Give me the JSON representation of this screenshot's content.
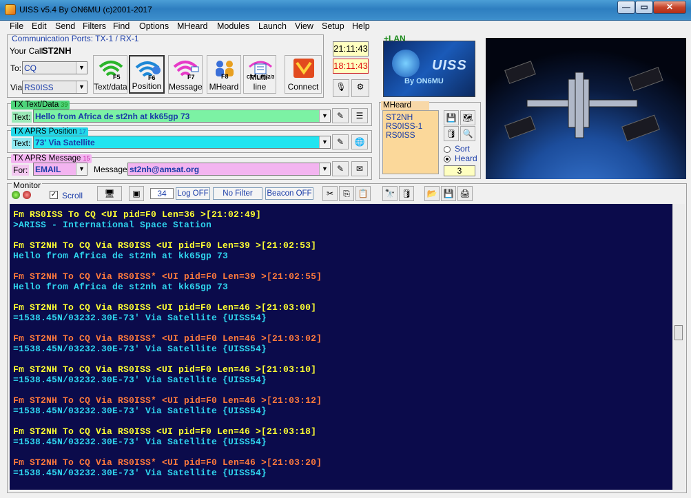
{
  "window": {
    "title": "UISS v5.4 By ON6MU (c)2001-2017",
    "controls": [
      "—",
      "▭",
      "✕"
    ]
  },
  "menu": [
    "File",
    "Edit",
    "Send",
    "Filters",
    "Find",
    "Options",
    "MHeard",
    "Modules",
    "Launch",
    "View",
    "Setup",
    "Help"
  ],
  "ports": {
    "title": "Communication Ports: TX-1 / RX-1",
    "your_call_label": "Your Call:",
    "your_call": "ST2NH",
    "to_label": "To:",
    "to_value": "CQ",
    "via_label": "Via:",
    "via_value": "RS0ISS"
  },
  "buttons": [
    {
      "label": "Text/data",
      "key": "F5"
    },
    {
      "label": "Position",
      "key": "F6"
    },
    {
      "label": "Message",
      "key": "F7"
    },
    {
      "label": "MHeard",
      "key": "F8"
    },
    {
      "label": "Multi-line",
      "key": "CTRL F1/2/3"
    },
    {
      "label": "Connect",
      "key": ""
    }
  ],
  "clocks": {
    "local": "21:11:43",
    "utc": "18:11:43"
  },
  "lan_label": "+LAN",
  "logo": {
    "text": "UISS",
    "byline": "By ON6MU"
  },
  "tx_text": {
    "title": "TX Text/Data",
    "count": "39",
    "label": "Text:",
    "value": "Hello from Africa de st2nh at kk65gp 73"
  },
  "tx_aprs_pos": {
    "title": "TX APRS Position",
    "count": "17",
    "label": "Text:",
    "value": "73' Via Satellite"
  },
  "tx_aprs_msg": {
    "title": "TX APRS Message",
    "count": "15",
    "for_label": "For:",
    "for_value": "EMAIL",
    "msg_label": "Message:",
    "msg_value": "st2nh@amsat.org"
  },
  "mheard": {
    "title": "MHeard",
    "items": [
      "ST2NH",
      "RS0ISS-1",
      "RS0ISS"
    ],
    "sort_label": "Sort",
    "heard_label": "Heard",
    "count": "3"
  },
  "monitor": {
    "title": "Monitor",
    "scroll_label": "Scroll",
    "count": "34",
    "log_btn": "Log OFF",
    "filter_btn": "No Filter",
    "beacon_btn": "Beacon OFF"
  },
  "console": [
    {
      "type": "hdr-y",
      "text": "Fm RS0ISS To CQ <UI pid=F0 Len=36 >[21:02:49]"
    },
    {
      "type": "body-c",
      "text": ">ARISS - International Space Station"
    },
    {
      "type": "hdr-y",
      "text": "Fm ST2NH To CQ Via RS0ISS <UI pid=F0 Len=39 >[21:02:53]"
    },
    {
      "type": "body-c",
      "text": "Hello from Africa de st2nh at kk65gp 73"
    },
    {
      "type": "hdr-o",
      "text": "Fm ST2NH To CQ Via RS0ISS* <UI pid=F0 Len=39 >[21:02:55]"
    },
    {
      "type": "body-c",
      "text": "Hello from Africa de st2nh at kk65gp 73"
    },
    {
      "type": "hdr-y",
      "text": "Fm ST2NH To CQ Via RS0ISS <UI pid=F0 Len=46 >[21:03:00]"
    },
    {
      "type": "body-c",
      "text": "=1538.45N/03232.30E-73' Via Satellite {UISS54}"
    },
    {
      "type": "hdr-o",
      "text": "Fm ST2NH To CQ Via RS0ISS* <UI pid=F0 Len=46 >[21:03:02]"
    },
    {
      "type": "body-c",
      "text": "=1538.45N/03232.30E-73' Via Satellite {UISS54}"
    },
    {
      "type": "hdr-y",
      "text": "Fm ST2NH To CQ Via RS0ISS <UI pid=F0 Len=46 >[21:03:10]"
    },
    {
      "type": "body-c",
      "text": "=1538.45N/03232.30E-73' Via Satellite {UISS54}"
    },
    {
      "type": "hdr-o",
      "text": "Fm ST2NH To CQ Via RS0ISS* <UI pid=F0 Len=46 >[21:03:12]"
    },
    {
      "type": "body-c",
      "text": "=1538.45N/03232.30E-73' Via Satellite {UISS54}"
    },
    {
      "type": "hdr-y",
      "text": "Fm ST2NH To CQ Via RS0ISS <UI pid=F0 Len=46 >[21:03:18]"
    },
    {
      "type": "body-c",
      "text": "=1538.45N/03232.30E-73' Via Satellite {UISS54}"
    },
    {
      "type": "hdr-o",
      "text": "Fm ST2NH To CQ Via RS0ISS* <UI pid=F0 Len=46 >[21:03:20]"
    },
    {
      "type": "body-c",
      "text": "=1538.45N/03232.30E-73' Via Satellite {UISS54}"
    }
  ],
  "colors": {
    "console_bg": "#0b0b4b",
    "hdr_yellow": "#ffff32",
    "hdr_orange": "#ff7a3c",
    "body_cyan": "#2fd4ee",
    "text_green": "#7cf2a4",
    "pos_cyan": "#22e4f0",
    "msg_pink": "#f3b4f0"
  }
}
